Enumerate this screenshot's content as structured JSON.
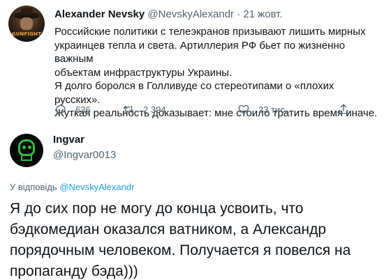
{
  "tweet": {
    "author_name": "Alexander Nevsky",
    "author_handle": "@NevskyAlexandr",
    "separator": "·",
    "date": "21 жовт.",
    "avatar_logo_text": "GUNFIGHT",
    "body_lines": [
      "Российские политики с телеэкранов призывают лишить мирных",
      "украинцев тепла и света. Артиллерия РФ бьет по жизненно важным",
      "объектам инфраструктуры Украины.",
      "Я долго боролся в Голливуде со стереотипами о «плохих русских».",
      "Жуткая реальность доказывает: мне стоило тратить время иначе."
    ],
    "actions": {
      "reply_count": "636",
      "retweet_count": "2 394",
      "like_count": "23 тис."
    }
  },
  "reply": {
    "author_name": "Ingvar",
    "author_handle": "@Ingvar0013",
    "reply_to_prefix": "У відповідь",
    "reply_to_mention": "@NevskyAlexandr",
    "body_text": "Я до сих пор не могу до конца усвоить, что бэдкомедиан оказался ватником, а Александр порядочным человеком. Получается я повелся на пропаганду бэда)))"
  },
  "colors": {
    "text": "#0f1419",
    "secondary": "#536471",
    "link": "#1d9bf0"
  }
}
